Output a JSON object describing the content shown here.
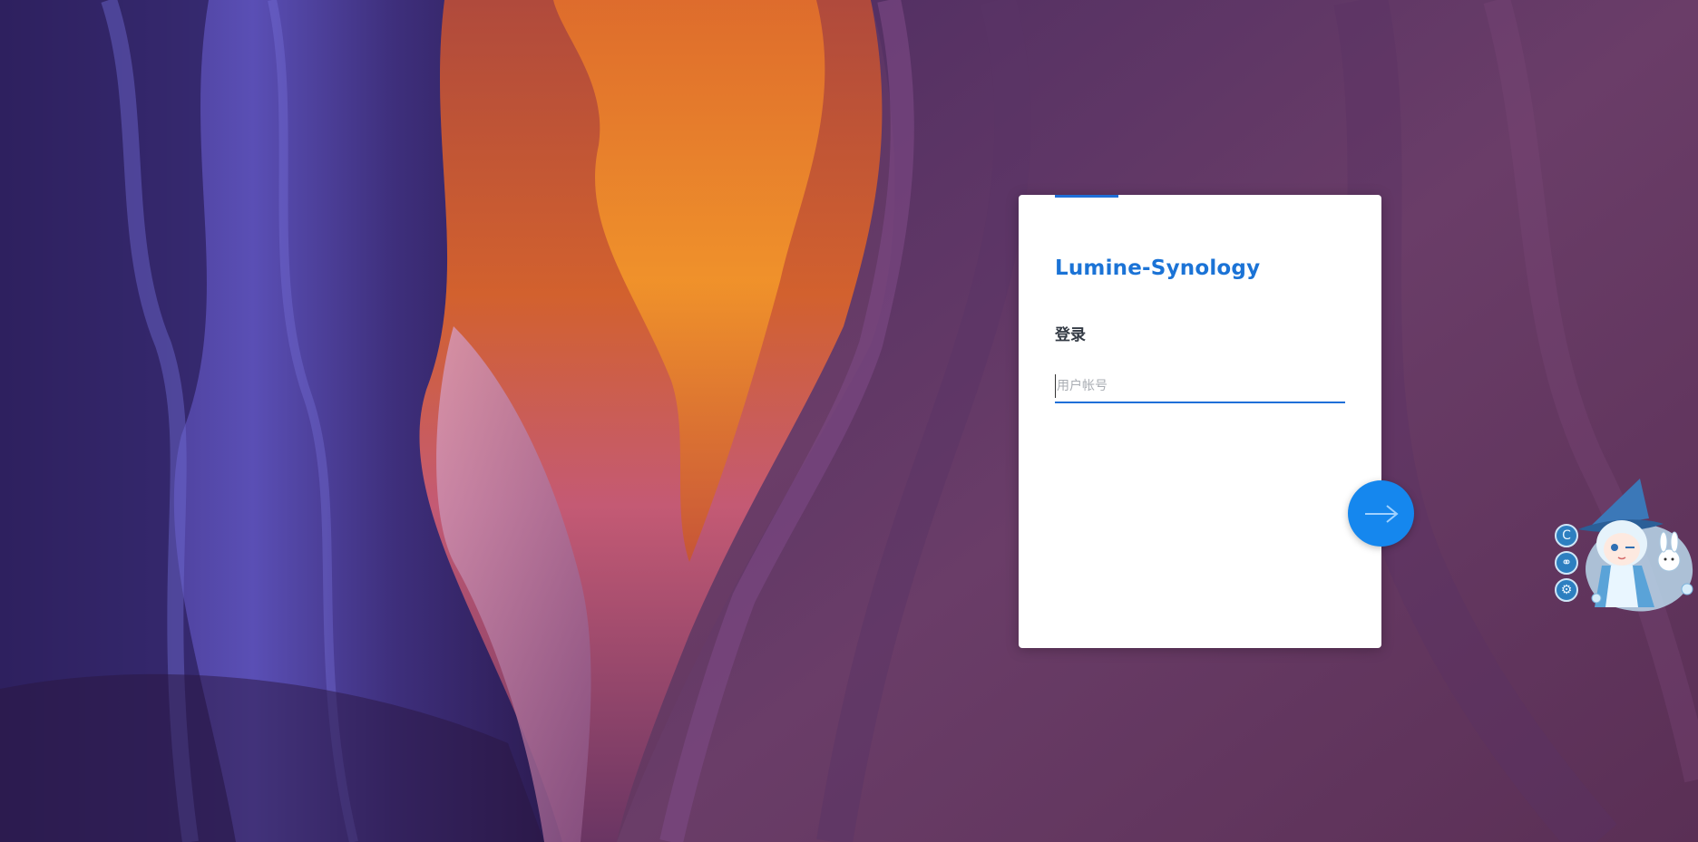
{
  "app": {
    "brand_title": "Lumine-Synology",
    "accent_color": "#1b73d6"
  },
  "login": {
    "heading": "登录",
    "username_placeholder": "用户帐号",
    "username_value": "",
    "next_button_icon": "arrow-right-icon"
  },
  "mascot": {
    "tools": [
      {
        "icon": "refresh-icon",
        "glyph": "C"
      },
      {
        "icon": "link-icon",
        "glyph": "⚭"
      },
      {
        "icon": "settings-icon",
        "glyph": "⚙"
      }
    ]
  }
}
